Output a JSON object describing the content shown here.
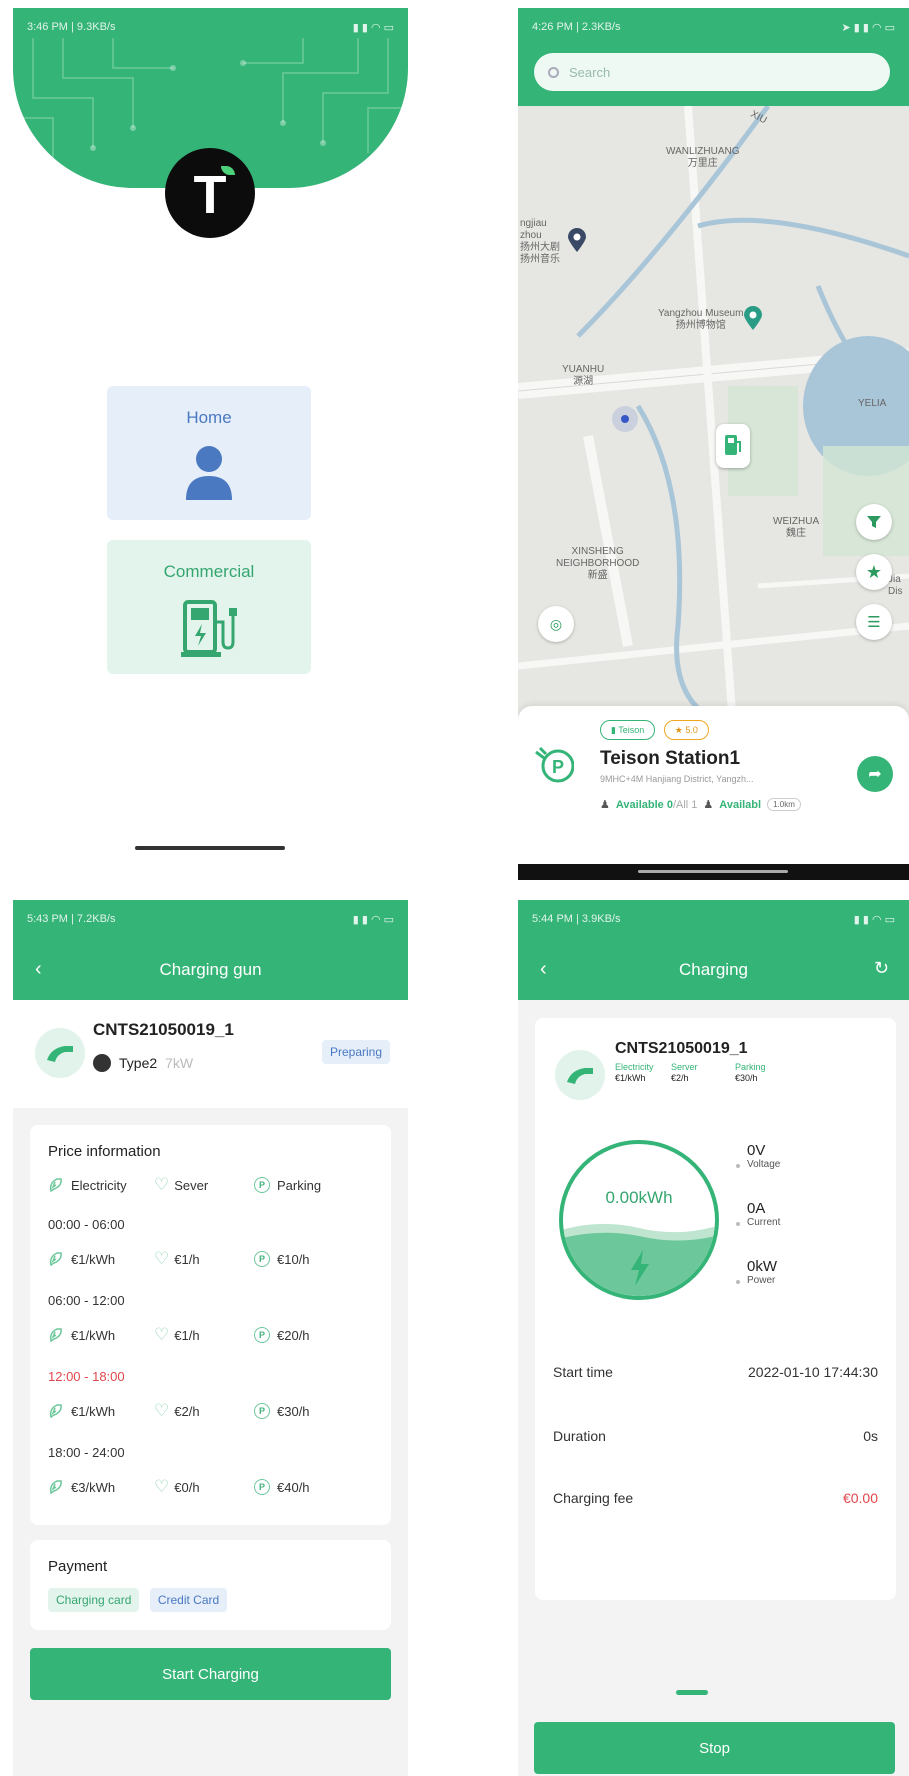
{
  "login": {
    "status_time": "3:46 PM | 9.3KB/s",
    "home_label": "Home",
    "commercial_label": "Commercial"
  },
  "map_screen": {
    "status_time": "4:26 PM | 2.3KB/s",
    "search_placeholder": "Search",
    "labels": {
      "wanlizhuang": "WANLIZHUANG",
      "wanlizhuang_cn": "万里庄",
      "museum": "Yangzhou Museum",
      "museum_cn": "扬州博物馆",
      "yuanhu": "YUANHU",
      "yuanhu_cn": "源湖",
      "weizhuang": "WEIZHUA",
      "weizhuang_cn": "魏庄",
      "xinsheng": "XINSHENG",
      "neighborhood": "NEIGHBORHOOD",
      "xinsheng_cn": "新盛",
      "road": "XIU",
      "left_top": "ngjiau",
      "left_mid": "zhou",
      "left_cn1": "扬州大剧",
      "left_cn2": "扬州音乐",
      "right_lake": "YELIA",
      "right_edge": "Jia",
      "right_edge2": "Dis"
    },
    "station": {
      "tag1": "Teison",
      "rating": "5.0",
      "name": "Teison Station1",
      "address": "9MHC+4M Hanjiang District, Yangzh...",
      "available_dc": "Available 0",
      "all_dc": "/All 1",
      "available_ac": "Availabl",
      "distance": "1.0km"
    }
  },
  "gun_screen": {
    "status_time": "5:43 PM | 7.2KB/s",
    "title": "Charging gun",
    "gun_id": "CNTS21050019_1",
    "connector": "Type2",
    "power": "7kW",
    "status": "Preparing",
    "price_title": "Price information",
    "legend": {
      "electricity": "Electricity",
      "sever": "Sever",
      "parking": "Parking"
    },
    "slots": [
      {
        "time": "00:00 - 06:00",
        "e": "€1/kWh",
        "s": "€1/h",
        "p": "€10/h",
        "active": false
      },
      {
        "time": "06:00 - 12:00",
        "e": "€1/kWh",
        "s": "€1/h",
        "p": "€20/h",
        "active": false
      },
      {
        "time": "12:00 - 18:00",
        "e": "€1/kWh",
        "s": "€2/h",
        "p": "€30/h",
        "active": true
      },
      {
        "time": "18:00 - 24:00",
        "e": "€3/kWh",
        "s": "€0/h",
        "p": "€40/h",
        "active": false
      }
    ],
    "payment_title": "Payment",
    "pay1": "Charging card",
    "pay2": "Credit Card",
    "start_button": "Start Charging"
  },
  "charging_screen": {
    "status_time": "5:44 PM | 3.9KB/s",
    "title": "Charging",
    "gun_id": "CNTS21050019_1",
    "electricity_label": "Electricity",
    "electricity_value": "€1/kWh",
    "server_label": "Server",
    "server_value": "€2/h",
    "parking_label": "Parking",
    "parking_value": "€30/h",
    "energy": "0.00kWh",
    "voltage_value": "0V",
    "voltage_label": "Voltage",
    "current_value": "0A",
    "current_label": "Current",
    "power_value": "0kW",
    "power_label": "Power",
    "start_time_label": "Start time",
    "start_time_value": "2022-01-10 17:44:30",
    "duration_label": "Duration",
    "duration_value": "0s",
    "fee_label": "Charging fee",
    "fee_value": "€0.00",
    "stop_button": "Stop"
  },
  "colors": {
    "brand_green": "#35b477",
    "home_blue": "#4a79c2",
    "fee_red": "#e0474c"
  }
}
